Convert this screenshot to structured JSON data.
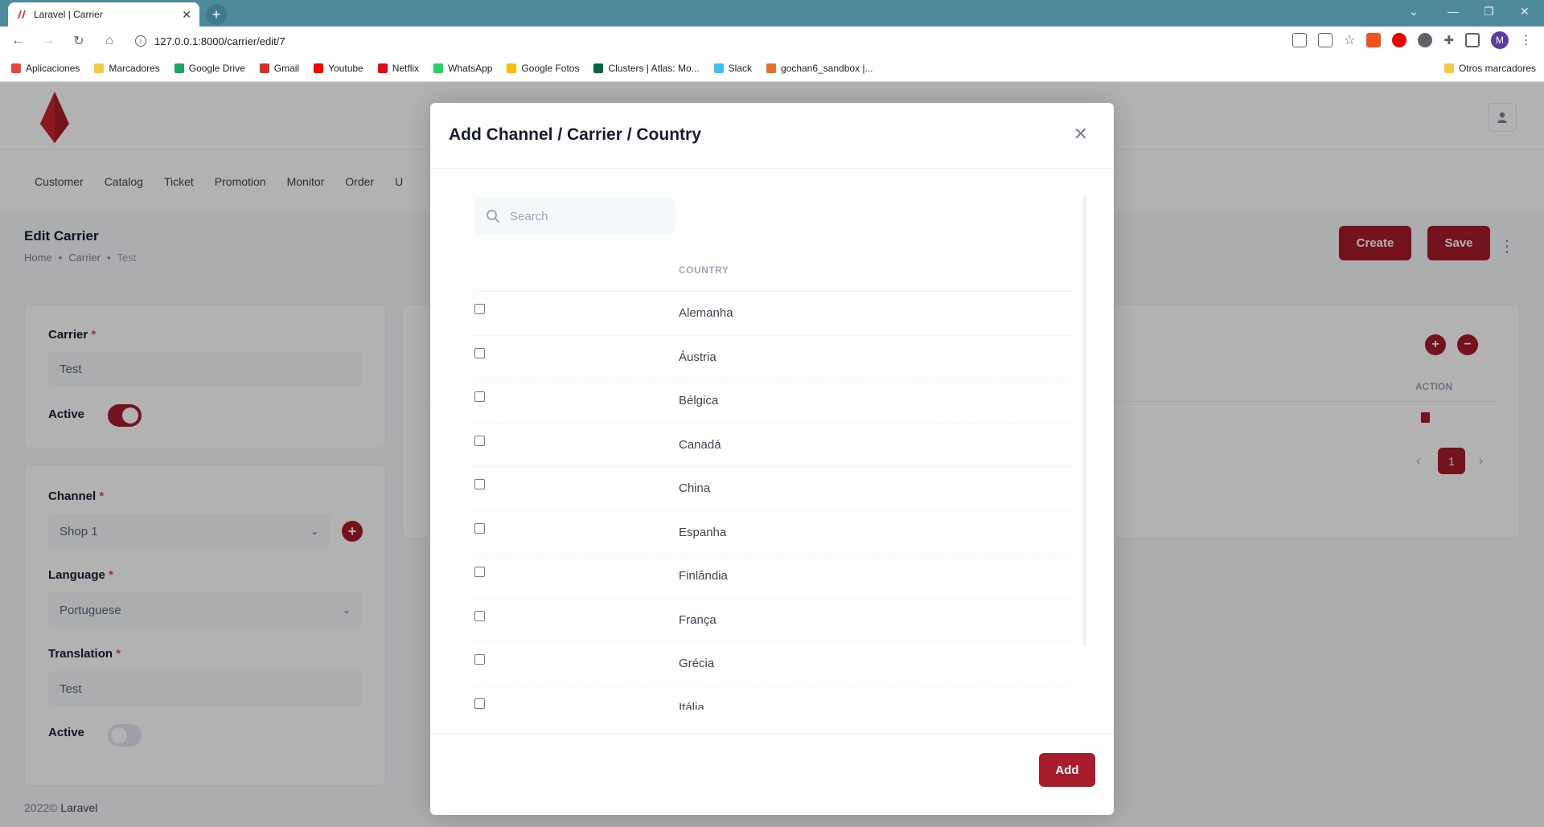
{
  "browser": {
    "tab_title": "Laravel | Carrier",
    "url": "127.0.0.1:8000/carrier/edit/7",
    "profile_initial": "M",
    "bookmarks": [
      {
        "label": "Aplicaciones",
        "color": "#e8453c"
      },
      {
        "label": "Marcadores",
        "color": "#f9c842"
      },
      {
        "label": "Google Drive",
        "color": "#1ea362"
      },
      {
        "label": "Gmail",
        "color": "#d93025"
      },
      {
        "label": "Youtube",
        "color": "#ff0000"
      },
      {
        "label": "Netflix",
        "color": "#e50914"
      },
      {
        "label": "WhatsApp",
        "color": "#25d366"
      },
      {
        "label": "Google Fotos",
        "color": "#fbbc04"
      },
      {
        "label": "Clusters | Atlas: Mo...",
        "color": "#00684a"
      },
      {
        "label": "Slack",
        "color": "#36c5f0"
      },
      {
        "label": "gochan6_sandbox |...",
        "color": "#e8702a"
      }
    ],
    "other_bookmarks": "Otros marcadores"
  },
  "app": {
    "menu": [
      "Customer",
      "Catalog",
      "Ticket",
      "Promotion",
      "Monitor",
      "Order",
      "U"
    ],
    "page_title": "Edit Carrier",
    "breadcrumb": [
      "Home",
      "Carrier",
      "Test"
    ],
    "create_label": "Create",
    "save_label": "Save",
    "carrier_label": "Carrier",
    "carrier_value": "Test",
    "active_label": "Active",
    "channel_label": "Channel",
    "channel_value": "Shop 1",
    "language_label": "Language",
    "language_value": "Portuguese",
    "translation_label": "Translation",
    "translation_value": "Test",
    "active2_label": "Active",
    "action_header": "ACTION",
    "page_number": "1",
    "footer_year": "2022©",
    "footer_brand": "Laravel",
    "accent": "#a61c2c"
  },
  "modal": {
    "title": "Add Channel / Carrier / Country",
    "search_placeholder": "Search",
    "column_header": "COUNTRY",
    "countries": [
      "Alemanha",
      "Áustria",
      "Bélgica",
      "Canadá",
      "China",
      "Espanha",
      "Finlândia",
      "França",
      "Grécia",
      "Itália"
    ],
    "add_label": "Add"
  }
}
